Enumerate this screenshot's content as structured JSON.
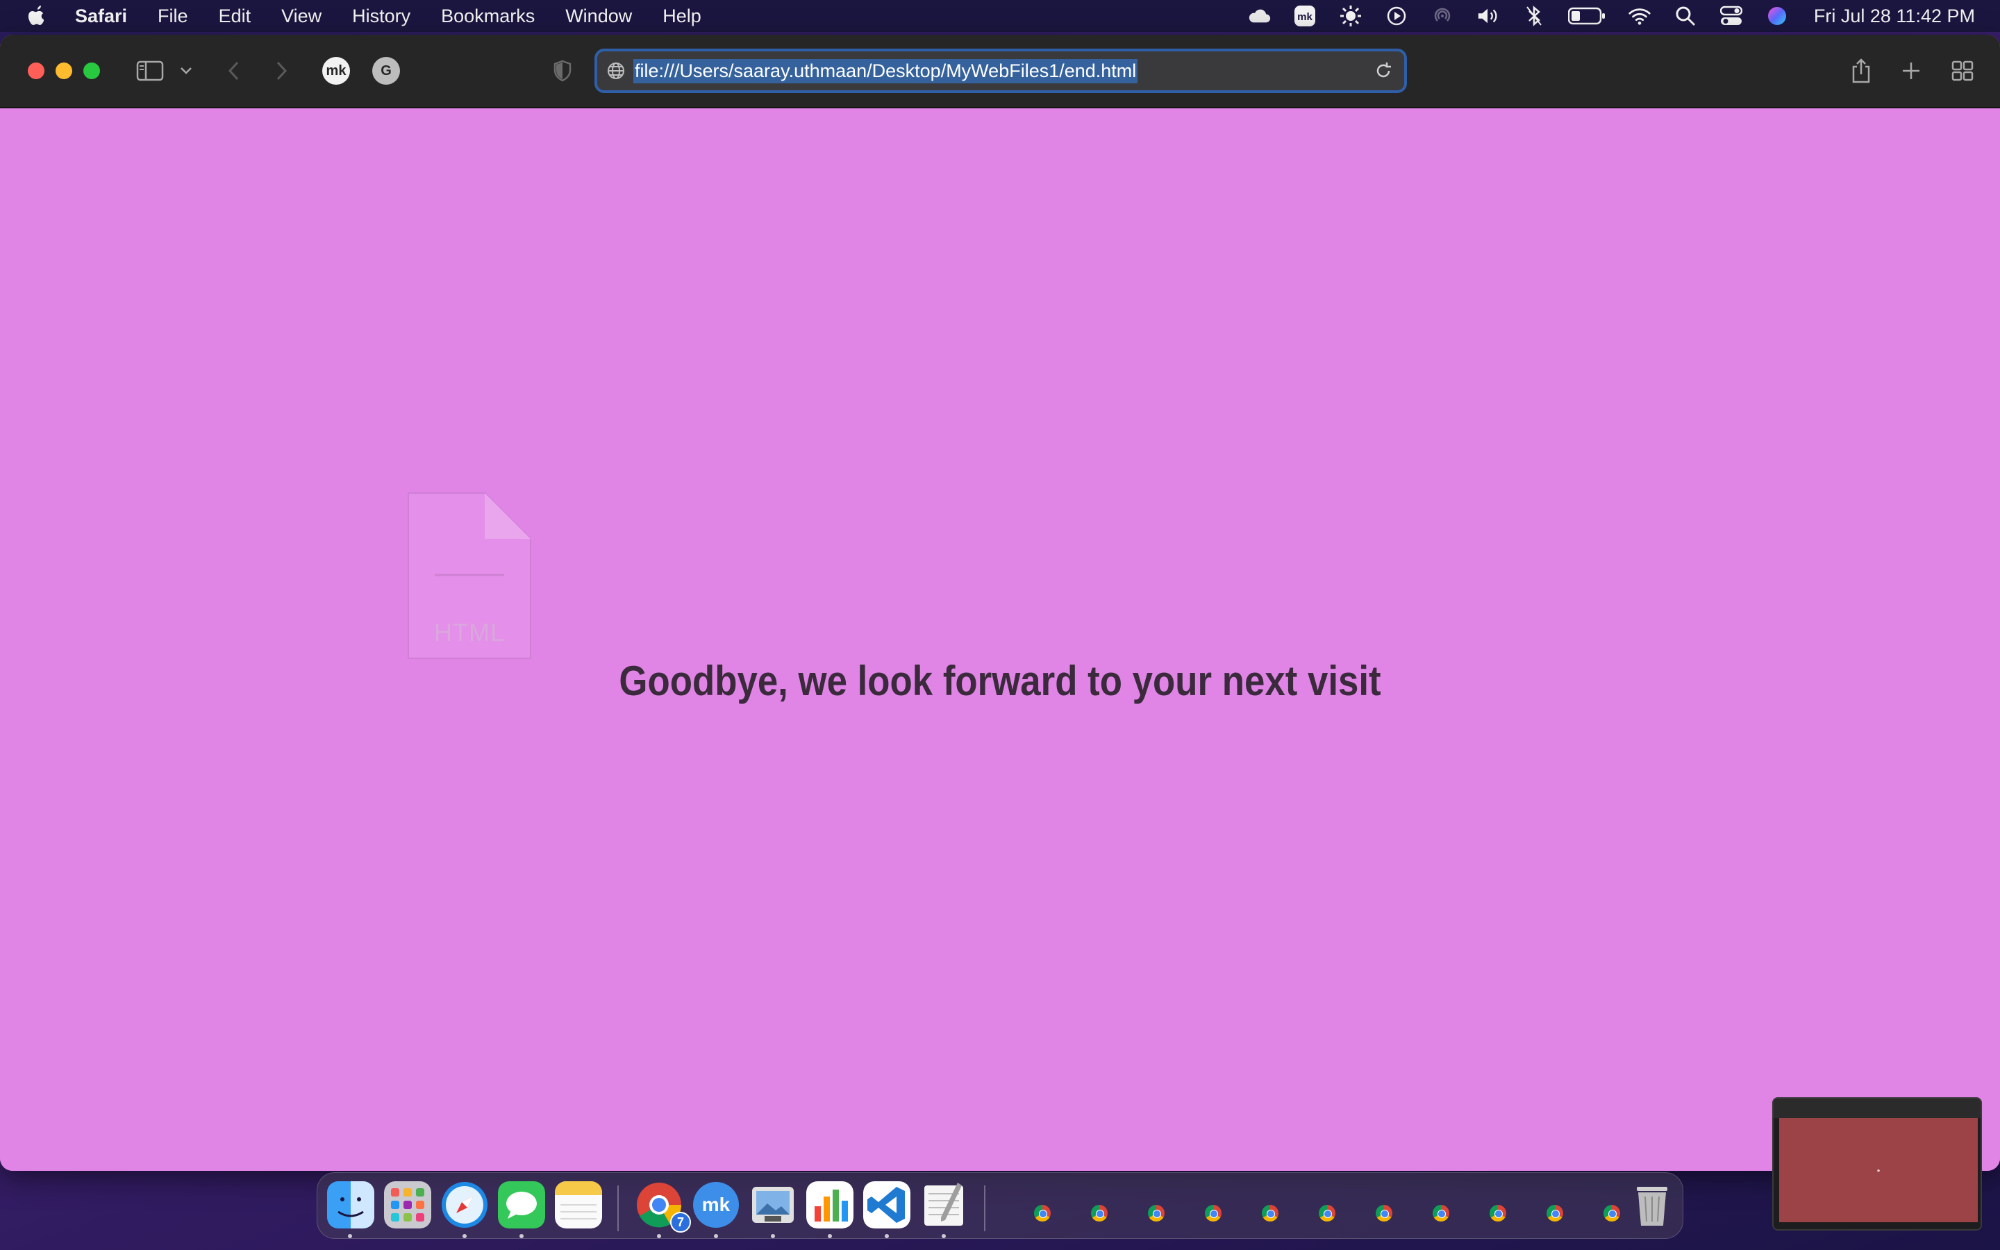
{
  "menubar": {
    "app_name": "Safari",
    "menus": [
      "File",
      "Edit",
      "View",
      "History",
      "Bookmarks",
      "Window",
      "Help"
    ],
    "clock": "Fri Jul 28  11:42 PM",
    "status_icons": [
      "cloud-icon",
      "mk-icon",
      "sun-icon",
      "play-icon",
      "airdrop-icon",
      "volume-icon",
      "bluetooth-icon",
      "battery-icon",
      "wifi-icon",
      "search-icon",
      "control-center-icon",
      "siri-icon"
    ]
  },
  "toolbar": {
    "extensions": [
      {
        "name": "mk-extension-icon",
        "label": "mk"
      },
      {
        "name": "grammarly-extension-icon",
        "label": "G"
      }
    ],
    "url": "file:///Users/saaray.uthmaan/Desktop/MyWebFiles1/end.html"
  },
  "page": {
    "file_icon_label": "HTML",
    "message": "Goodbye, we look forward to your next visit"
  },
  "dock": {
    "chrome_badge": "7",
    "apps": [
      "finder-icon",
      "launchpad-icon",
      "safari-icon",
      "messages-icon",
      "notes-icon",
      "chrome-icon",
      "mk-app-icon",
      "preview-icon",
      "numbers-icon",
      "vscode-icon",
      "textedit-icon"
    ],
    "minimized_windows": 11
  },
  "colors": {
    "page_background": "#e084e6",
    "text": "#3a2a3c",
    "url_focus_ring": "#2f5fa8"
  }
}
